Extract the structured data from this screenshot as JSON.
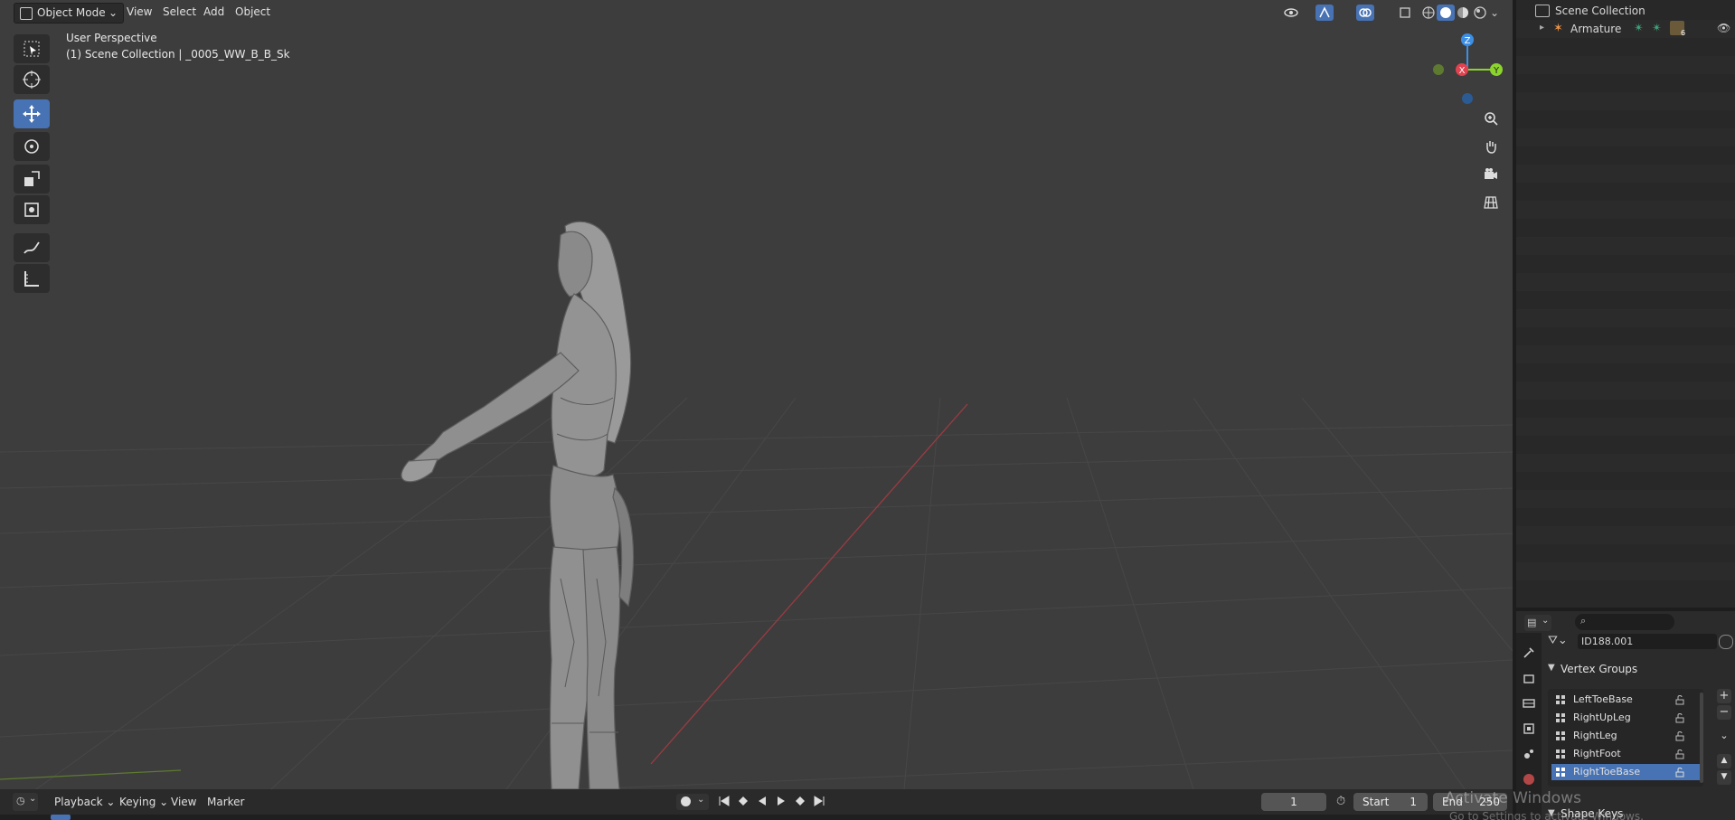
{
  "viewport": {
    "header": {
      "mode": "Object Mode",
      "menus": [
        "View",
        "Select",
        "Add",
        "Object"
      ]
    },
    "overlay": {
      "perspective": "User Perspective",
      "collection": "(1) Scene Collection | _0005_WW_B_B_Sk"
    },
    "gizmo": {
      "x": "X",
      "y": "Y",
      "z": "Z"
    },
    "colors": {
      "x_axis": "#e0424f",
      "y_axis": "#8bd42c",
      "z_axis": "#3d8fe5",
      "accent": "#4772b3"
    }
  },
  "outliner": {
    "root": "Scene Collection",
    "items": [
      {
        "label": "Armature",
        "badge": "6"
      }
    ]
  },
  "properties": {
    "search_placeholder": "",
    "object_name": "ID188.001",
    "panel_title": "Vertex Groups",
    "vertex_groups": [
      "LeftToeBase",
      "RightUpLeg",
      "RightLeg",
      "RightFoot",
      "RightToeBase"
    ],
    "selected_group": "RightToeBase",
    "next_panel": "Shape Keys"
  },
  "timeline": {
    "menus": [
      "Playback",
      "Keying",
      "View",
      "Marker"
    ],
    "current_frame": "1",
    "start_label": "Start",
    "start_value": "1",
    "end_label": "End",
    "end_value": "250",
    "watermark_line1": "Activate Windows",
    "watermark_line2": "Go to Settings to activate Windows."
  }
}
